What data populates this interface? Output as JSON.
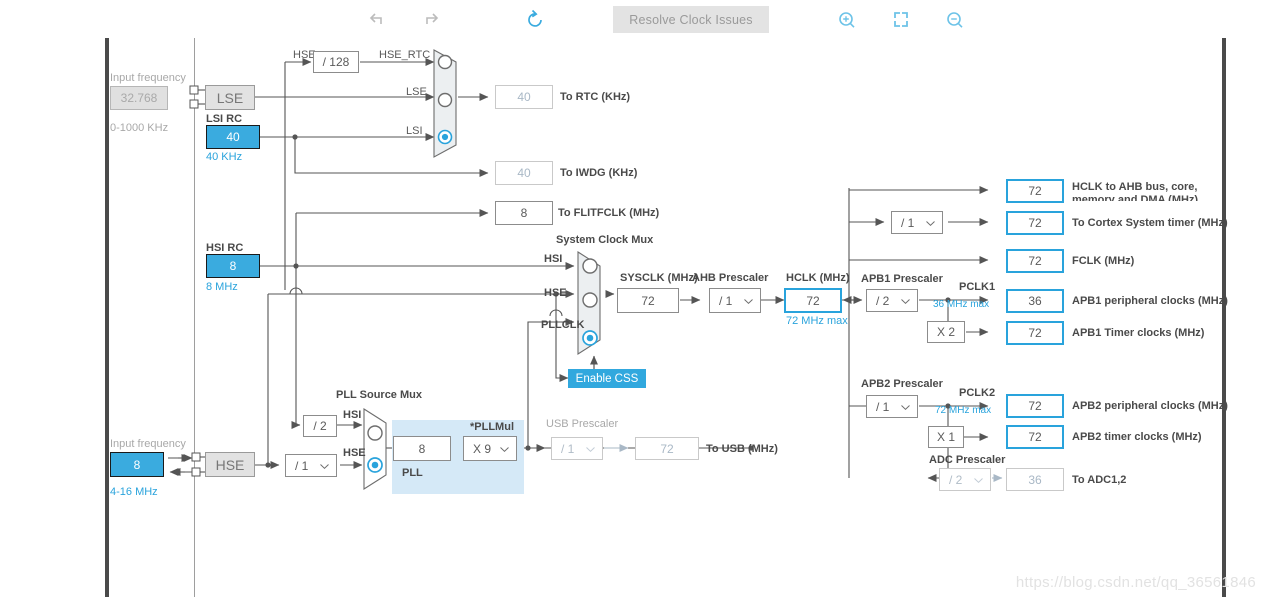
{
  "toolbar": {
    "undo_icon": "undo-icon",
    "redo_icon": "redo-icon",
    "reset_icon": "reset-icon",
    "resolve_label": "Resolve Clock Issues",
    "zoom_in_icon": "zoom-in-icon",
    "fit_icon": "fit-to-screen-icon",
    "zoom_out_icon": "zoom-out-icon"
  },
  "lse": {
    "input_frequency_label": "Input frequency",
    "value": "32.768",
    "range": "0-1000 KHz",
    "osc_label": "LSE"
  },
  "lsi": {
    "title": "LSI RC",
    "value": "40",
    "unit": "40 KHz"
  },
  "hsi": {
    "title": "HSI RC",
    "value": "8",
    "unit": "8 MHz"
  },
  "hse": {
    "input_frequency_label": "Input frequency",
    "value": "8",
    "range": "4-16 MHz",
    "osc_label": "HSE",
    "div_label": "HSE",
    "rtc_div": "/ 128",
    "hse_rtc_label": "HSE_RTC",
    "prescaler": "/ 1"
  },
  "rtc_mux": {
    "inputs": [
      "HSE_RTC",
      "LSE",
      "LSI"
    ],
    "selected_index": 2
  },
  "outputs": {
    "rtc": {
      "value": "40",
      "label": "To RTC (KHz)"
    },
    "iwdg": {
      "value": "40",
      "label": "To IWDG (KHz)"
    },
    "flitfclk": {
      "value": "8",
      "label": "To FLITFCLK (MHz)"
    },
    "usb": {
      "value": "72",
      "label": "To USB (MHz)"
    },
    "adc": {
      "value": "36",
      "label": "To ADC1,2"
    }
  },
  "pll": {
    "source_mux_title": "PLL Source Mux",
    "hsi_div": "/ 2",
    "input_hsi_label": "HSI",
    "input_hse_label": "HSE",
    "selected_source": "HSE",
    "panel_label": "PLL",
    "input_value": "8",
    "mul_title": "*PLLMul",
    "mul_value": "X 9"
  },
  "sysclk_mux": {
    "title": "System Clock Mux",
    "inputs": [
      "HSI",
      "HSE",
      "PLLCLK"
    ],
    "selected_index": 2,
    "enable_css_label": "Enable CSS"
  },
  "sysclk": {
    "title": "SYSCLK (MHz)",
    "value": "72"
  },
  "ahb_prescaler": {
    "title": "AHB Prescaler",
    "value": "/ 1"
  },
  "hclk": {
    "title": "HCLK (MHz)",
    "value": "72",
    "max": "72 MHz max"
  },
  "usb_prescaler": {
    "title": "USB Prescaler",
    "value": "/ 1"
  },
  "ahb_outputs": [
    {
      "value": "72",
      "label": "HCLK to AHB bus, core, memory and DMA (MHz)"
    },
    {
      "value": "72",
      "label": "To Cortex System timer (MHz)",
      "prescaler": "/ 1"
    },
    {
      "value": "72",
      "label": "FCLK (MHz)"
    }
  ],
  "apb1": {
    "prescaler_title": "APB1 Prescaler",
    "prescaler_value": "/ 2",
    "pclk_label": "PCLK1",
    "max": "36 MHz max",
    "peripheral": {
      "value": "36",
      "label": "APB1 peripheral clocks (MHz)"
    },
    "timer_mul": "X 2",
    "timer": {
      "value": "72",
      "label": "APB1 Timer clocks (MHz)"
    }
  },
  "apb2": {
    "prescaler_title": "APB2 Prescaler",
    "prescaler_value": "/ 1",
    "pclk_label": "PCLK2",
    "max": "72 MHz max",
    "peripheral": {
      "value": "72",
      "label": "APB2 peripheral clocks (MHz)"
    },
    "timer_mul": "X 1",
    "timer": {
      "value": "72",
      "label": "APB2 timer clocks (MHz)"
    },
    "adc_prescaler_title": "ADC Prescaler",
    "adc_prescaler_value": "/ 2"
  },
  "watermark": "https://blog.csdn.net/qq_36561846",
  "colors": {
    "accent": "#29a3dc",
    "fill": "#3aabdf",
    "wire": "#555555",
    "rail": "#4a4a4a"
  }
}
